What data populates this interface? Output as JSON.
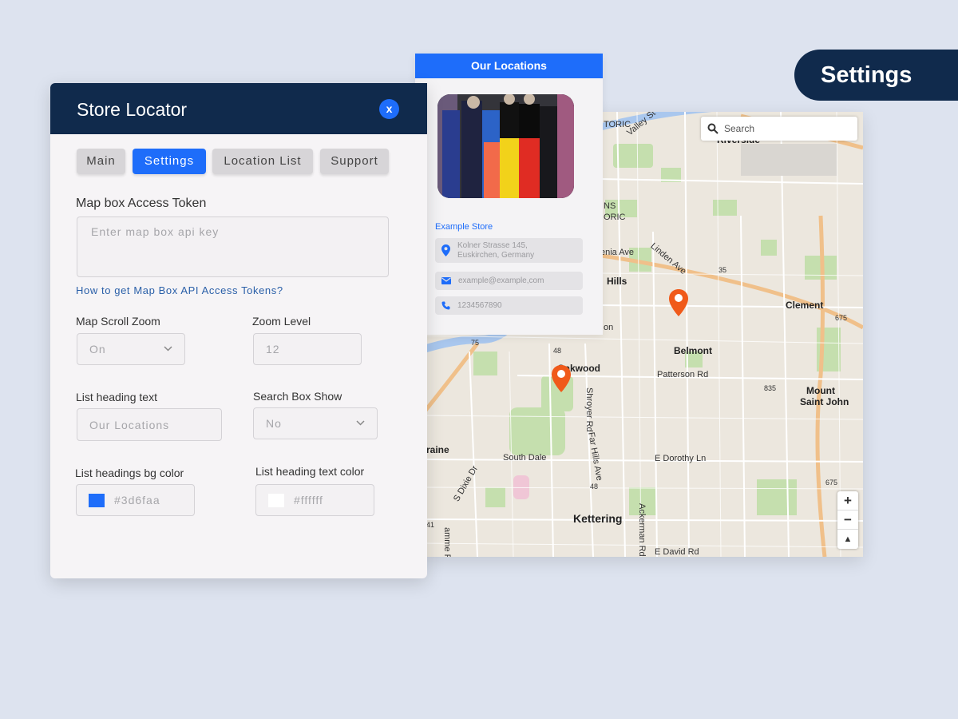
{
  "badge": {
    "label": "Settings"
  },
  "map": {
    "search_placeholder": "Search",
    "zoom_in": "+",
    "zoom_out": "−",
    "compass": "▲",
    "labels": {
      "riverside": "Riverside",
      "valley_st": "Valley St",
      "toric": "TORIC",
      "oric": "ORIC",
      "dayton_ns": "NS",
      "enia_ave": "enia Ave",
      "linden_ave": "Linden Ave",
      "hills": "Hills",
      "clement": "Clement",
      "r35": "35",
      "r675a": "675",
      "on": "on",
      "r75": "75",
      "r48a": "48",
      "oakwood": "Oakwood",
      "belmont": "Belmont",
      "patterson": "Patterson Rd",
      "r835": "835",
      "mount_st_john_1": "Mount",
      "mount_st_john_2": "Saint John",
      "shroyer": "Shroyer Rd",
      "far_hills": "Far Hills Ave",
      "raine": "raine",
      "south_dale": "South Dale",
      "e_dorothy": "E Dorothy Ln",
      "s_dixie": "S Dixie Dr",
      "r48b": "48",
      "r675b": "675",
      "r41": "41",
      "kettering": "Kettering",
      "amme": "amme Rd",
      "ackerman": "Ackerman Rd",
      "e_david": "E David Rd"
    }
  },
  "locations_card": {
    "heading": "Our Locations",
    "store_name": "Example Store",
    "address_line1": "Kolner Strasse 145,",
    "address_line2": "Euskirchen, Germany",
    "email": "example@example,com",
    "phone": "1234567890"
  },
  "dialog": {
    "title": "Store Locator",
    "close": "x",
    "tabs": [
      "Main",
      "Settings",
      "Location List",
      "Support"
    ],
    "active_tab": "Settings",
    "token_label": "Map box Access Token",
    "token_placeholder": "Enter map box api key",
    "token_help_link": "How to get Map Box API Access Tokens?",
    "scroll_zoom_label": "Map Scroll Zoom",
    "scroll_zoom_value": "On",
    "zoom_level_label": "Zoom Level",
    "zoom_level_value": "12",
    "list_heading_label": "List heading text",
    "list_heading_value": "Our Locations",
    "search_box_label": "Search Box Show",
    "search_box_value": "No",
    "bg_color_label": "List headings bg color",
    "bg_color_value": "#3d6faa",
    "text_color_label": "List heading text color",
    "text_color_value": "#ffffff"
  },
  "colors": {
    "navy": "#102a4c",
    "accent_blue": "#1e6dfa",
    "pin_orange": "#f05a1a",
    "swatch_bg": "#1e6dfa",
    "swatch_text": "#ffffff"
  }
}
